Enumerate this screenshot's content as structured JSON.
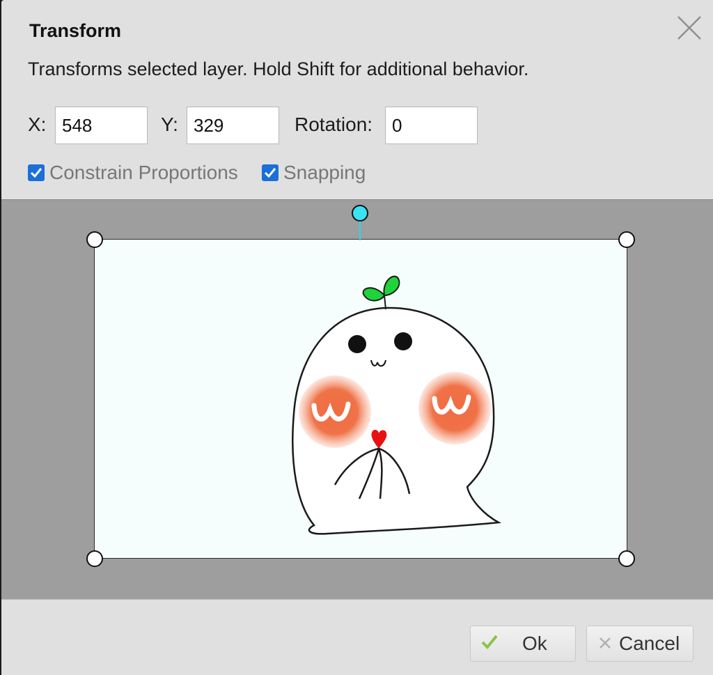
{
  "dialog": {
    "title": "Transform",
    "description": "Transforms selected layer. Hold Shift for additional behavior."
  },
  "fields": {
    "x_label": "X:",
    "x_value": "548",
    "y_label": "Y:",
    "y_value": "329",
    "rotation_label": "Rotation:",
    "rotation_value": "0"
  },
  "options": {
    "constrain_label": "Constrain Proportions",
    "constrain_checked": true,
    "snapping_label": "Snapping",
    "snapping_checked": true
  },
  "buttons": {
    "ok_label": "Ok",
    "cancel_label": "Cancel"
  },
  "icons": {
    "close": "close-icon",
    "ok": "checkmark-icon",
    "cancel": "x-icon"
  },
  "colors": {
    "checkbox": "#1a6fd8",
    "rotation_handle": "#3be3f2",
    "ok_check": "#8ac44a"
  }
}
